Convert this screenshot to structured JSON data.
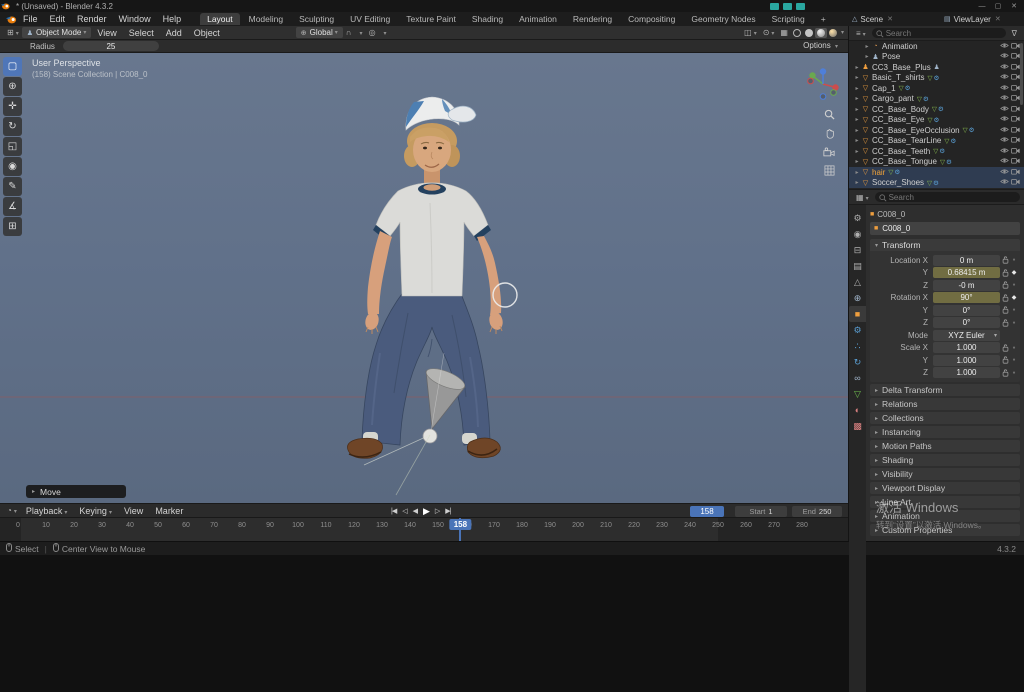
{
  "titlebar": {
    "title": "* (Unsaved) - Blender 4.3.2",
    "window_controls": [
      "minimize",
      "maximize",
      "close"
    ]
  },
  "topbar": {
    "menus": [
      "File",
      "Edit",
      "Render",
      "Window",
      "Help"
    ],
    "workspaces": [
      "Layout",
      "Modeling",
      "Sculpting",
      "UV Editing",
      "Texture Paint",
      "Shading",
      "Animation",
      "Rendering",
      "Compositing",
      "Geometry Nodes",
      "Scripting"
    ],
    "active_workspace": "Layout",
    "new_workspace_label": "+",
    "scene_selector": "Scene",
    "view_layer_selector": "ViewLayer"
  },
  "viewport_header": {
    "mode_selector": "Object Mode",
    "menus": [
      "View",
      "Select",
      "Add",
      "Object"
    ],
    "orientation": "Global"
  },
  "tool_header": {
    "radius_label": "Radius",
    "radius_value": "25",
    "options_label": "Options"
  },
  "toolbar_tools": [
    {
      "name": "select-box",
      "glyph": "▢",
      "active": true
    },
    {
      "name": "cursor",
      "glyph": "⊕"
    },
    {
      "name": "move",
      "glyph": "✛"
    },
    {
      "name": "rotate",
      "glyph": "↻"
    },
    {
      "name": "scale",
      "glyph": "◱"
    },
    {
      "name": "transform",
      "glyph": "◉"
    },
    {
      "name": "annotate",
      "glyph": "✎"
    },
    {
      "name": "measure",
      "glyph": "∡"
    },
    {
      "name": "add-cube",
      "glyph": "⊞"
    }
  ],
  "viewport": {
    "view_label": "User Perspective",
    "context_label": "(158) Scene Collection | C008_0",
    "operator_panel": "Move"
  },
  "icon_map": {
    "action-icon": {
      "glyph": "◔",
      "color": "#cf8f4e"
    },
    "pose-icon": {
      "glyph": "♟",
      "color": "#9fb3c8"
    },
    "armature-icon": {
      "glyph": "♟",
      "color": "#ee9e3e"
    },
    "mesh-icon": {
      "glyph": "▽",
      "color": "#ee9e3e"
    },
    "mesh-data-icon": {
      "glyph": "▽",
      "color": "#8cc050"
    },
    "modifier-icon": {
      "glyph": "⚙",
      "color": "#5a9fd4"
    }
  },
  "outliner": {
    "search_placeholder": "Search",
    "items": [
      {
        "label": "Animation",
        "icon": "action-icon",
        "indent": 1,
        "badges": []
      },
      {
        "label": "Pose",
        "icon": "pose-icon",
        "indent": 1,
        "badges": []
      },
      {
        "label": "CC3_Base_Plus",
        "icon": "armature-icon",
        "indent": 0,
        "badges": [
          "pose-icon"
        ]
      },
      {
        "label": "Basic_T_shirts",
        "icon": "mesh-icon",
        "indent": 0,
        "badges": [
          "mesh-data-icon",
          "modifier-icon"
        ]
      },
      {
        "label": "Cap_1",
        "icon": "mesh-icon",
        "indent": 0,
        "badges": [
          "mesh-data-icon",
          "modifier-icon"
        ]
      },
      {
        "label": "Cargo_pant",
        "icon": "mesh-icon",
        "indent": 0,
        "badges": [
          "mesh-data-icon",
          "modifier-icon"
        ]
      },
      {
        "label": "CC_Base_Body",
        "icon": "mesh-icon",
        "indent": 0,
        "badges": [
          "mesh-data-icon",
          "modifier-icon"
        ]
      },
      {
        "label": "CC_Base_Eye",
        "icon": "mesh-icon",
        "indent": 0,
        "badges": [
          "mesh-data-icon",
          "modifier-icon"
        ]
      },
      {
        "label": "CC_Base_EyeOcclusion",
        "icon": "mesh-icon",
        "indent": 0,
        "badges": [
          "mesh-data-icon",
          "modifier-icon"
        ]
      },
      {
        "label": "CC_Base_TearLine",
        "icon": "mesh-icon",
        "indent": 0,
        "badges": [
          "mesh-data-icon",
          "modifier-icon"
        ]
      },
      {
        "label": "CC_Base_Teeth",
        "icon": "mesh-icon",
        "indent": 0,
        "badges": [
          "mesh-data-icon",
          "modifier-icon"
        ]
      },
      {
        "label": "CC_Base_Tongue",
        "icon": "mesh-icon",
        "indent": 0,
        "badges": [
          "mesh-data-icon",
          "modifier-icon"
        ]
      },
      {
        "label": "hair",
        "icon": "mesh-icon",
        "indent": 0,
        "badges": [
          "mesh-data-icon",
          "modifier-icon"
        ],
        "selected": true,
        "active": true
      },
      {
        "label": "Soccer_Shoes",
        "icon": "mesh-icon",
        "indent": 0,
        "badges": [
          "mesh-data-icon",
          "modifier-icon"
        ],
        "selected": true
      }
    ]
  },
  "properties": {
    "search_placeholder": "Search",
    "breadcrumb": "C008_0",
    "object_name": "C008_0",
    "tabs": [
      {
        "name": "tool",
        "glyph": "⚙",
        "color": "#b0b0b0"
      },
      {
        "name": "render",
        "glyph": "◉",
        "color": "#b0b0b0"
      },
      {
        "name": "output",
        "glyph": "⊟",
        "color": "#b0b0b0"
      },
      {
        "name": "view-layer",
        "glyph": "▤",
        "color": "#b0b0b0"
      },
      {
        "name": "scene",
        "glyph": "△",
        "color": "#b0b0b0"
      },
      {
        "name": "world",
        "glyph": "⊕",
        "color": "#9fb3c8"
      },
      {
        "name": "object",
        "glyph": "■",
        "color": "#ee9e3e",
        "active": true
      },
      {
        "name": "modifiers",
        "glyph": "⚙",
        "color": "#5a9fd4"
      },
      {
        "name": "particles",
        "glyph": "∴",
        "color": "#5a9fd4"
      },
      {
        "name": "physics",
        "glyph": "↻",
        "color": "#5a9fd4"
      },
      {
        "name": "constraints",
        "glyph": "∞",
        "color": "#9fb3c8"
      },
      {
        "name": "object-data",
        "glyph": "▽",
        "color": "#6fbf4f"
      },
      {
        "name": "material",
        "glyph": "◐",
        "color": "#d98080"
      },
      {
        "name": "texture",
        "glyph": "▩",
        "color": "#d98080"
      }
    ],
    "transform": {
      "title": "Transform",
      "rows": [
        {
          "label": "Location X",
          "value": "0 m",
          "lock": true,
          "decor": "dot"
        },
        {
          "label": "Y",
          "value": "0.68415 m",
          "lock": true,
          "keyed": true,
          "decor": "diamond"
        },
        {
          "label": "Z",
          "value": "-0 m",
          "lock": true,
          "decor": "dot"
        },
        {
          "label": "Rotation X",
          "value": "90°",
          "lock": true,
          "keyed": true,
          "decor": "diamond"
        },
        {
          "label": "Y",
          "value": "0°",
          "lock": true,
          "decor": "dot"
        },
        {
          "label": "Z",
          "value": "0°",
          "lock": true,
          "decor": "dot"
        },
        {
          "label": "Mode",
          "value": "XYZ Euler",
          "dropdown": true
        },
        {
          "label": "Scale X",
          "value": "1.000",
          "lock": true,
          "decor": "dot"
        },
        {
          "label": "Y",
          "value": "1.000",
          "lock": true,
          "decor": "dot"
        },
        {
          "label": "Z",
          "value": "1.000",
          "lock": true,
          "decor": "dot"
        }
      ]
    },
    "sections": [
      "Delta Transform",
      "Relations",
      "Collections",
      "Instancing",
      "Motion Paths",
      "Shading",
      "Visibility",
      "Viewport Display",
      "Line Art",
      "Animation",
      "Custom Properties"
    ]
  },
  "timeline": {
    "menus": [
      "Playback",
      "Keying",
      "View",
      "Marker"
    ],
    "transport": [
      {
        "name": "jump-to-start",
        "glyph": "|◀"
      },
      {
        "name": "prev-keyframe",
        "glyph": "◁"
      },
      {
        "name": "play-reverse",
        "glyph": "◀"
      },
      {
        "name": "play",
        "glyph": "▶"
      },
      {
        "name": "next-keyframe",
        "glyph": "▷"
      },
      {
        "name": "jump-to-end",
        "glyph": "▶|"
      }
    ],
    "current_frame": "158",
    "start_label": "Start",
    "start_value": "1",
    "end_label": "End",
    "end_value": "250",
    "ruler": {
      "min": 0,
      "max": 280,
      "step": 10
    }
  },
  "statusbar": {
    "items": [
      "Select",
      "Center View to Mouse"
    ],
    "version": "4.3.2"
  },
  "watermark": {
    "line1": "激活 Windows",
    "line2": "转到“设置”以激活 Windows。"
  }
}
